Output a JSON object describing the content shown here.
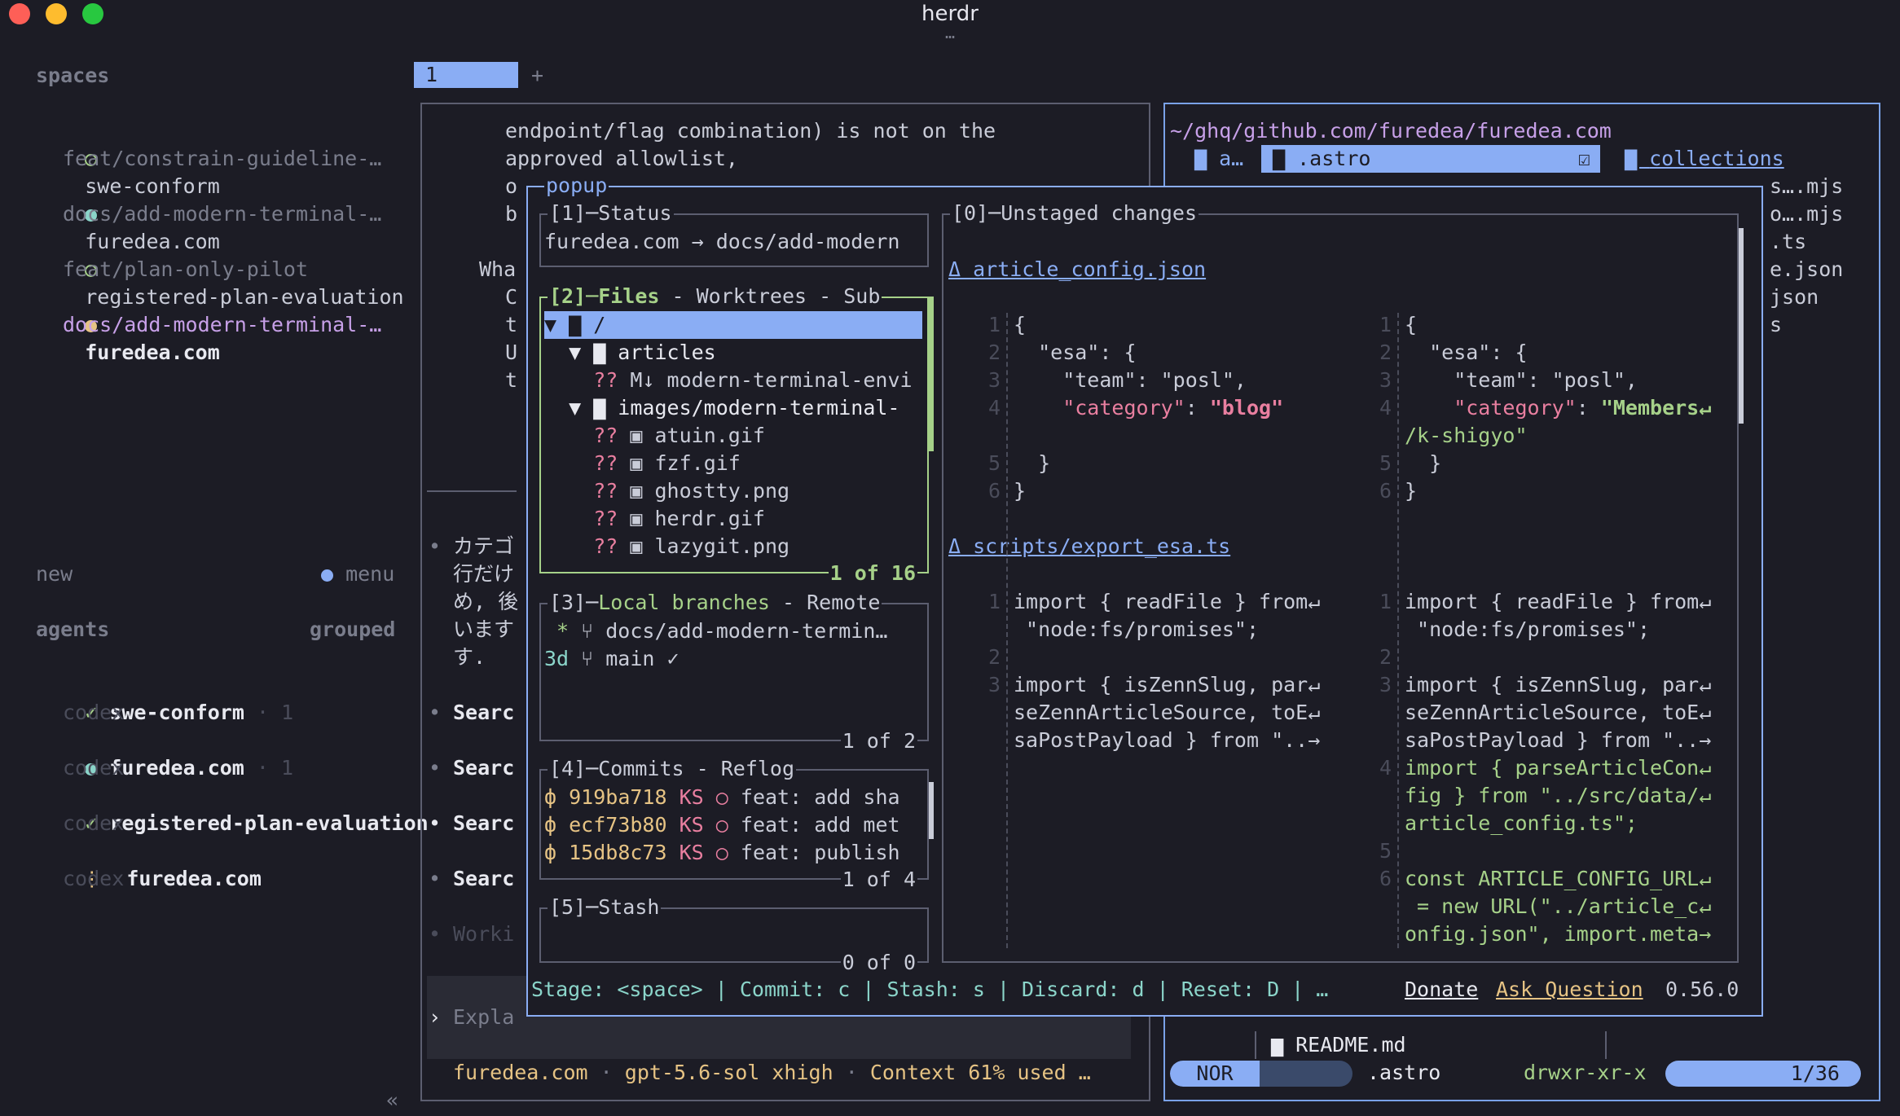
{
  "window": {
    "title": "herdr",
    "handle": "…"
  },
  "sidebar": {
    "spaces_header": "spaces",
    "spaces": [
      {
        "name": "swe-conform",
        "branch": "feat/constrain-guideline-…"
      },
      {
        "name": "furedea.com",
        "branch": "docs/add-modern-terminal-…"
      },
      {
        "name": "registered-plan-evaluation",
        "branch": "feat/plan-only-pilot"
      },
      {
        "name": "furedea.com",
        "branch": "docs/add-modern-terminal-…"
      }
    ],
    "new_label": "new",
    "menu_label": "menu",
    "agents_header": "agents",
    "grouped_label": "grouped",
    "agents": [
      {
        "mark": "✓",
        "name": "swe-conform",
        "count": "· 1",
        "tool": "codex"
      },
      {
        "mark": "",
        "name": "furedea.com",
        "count": "· 1",
        "tool": "codex"
      },
      {
        "mark": "✓",
        "name": "registered-plan-evaluation",
        "count": "",
        "tool": "codex"
      },
      {
        "mark": "⋮",
        "name": "furedea.com",
        "count": "",
        "tool": "codex"
      }
    ],
    "collapse": "«"
  },
  "tabs": {
    "active": "1",
    "add": "+"
  },
  "left_pane": {
    "lines": [
      "endpoint/flag combination) is not on the",
      "approved allowlist,"
    ],
    "frag_o": "o",
    "frag_b": "b",
    "frag_wha": "Wha",
    "frag_col": [
      "C",
      "t",
      "U",
      "t"
    ],
    "bullet_jp": [
      "カテゴ",
      "行だけ",
      "め, 後",
      "います",
      "す."
    ],
    "bullets": [
      "Searc",
      "Searc",
      "Searc",
      "Searc",
      "Worki"
    ],
    "bullet_mark": "•",
    "prompt_mark": "›",
    "prompt": "Expla",
    "status_repo": "furedea.com",
    "status_sep": "·",
    "status_model": "gpt-5.6-sol xhigh",
    "status_context": "Context 61% used …"
  },
  "right_pane": {
    "path": "~/ghq/github.com/furedea/furedea.com",
    "tab_a": "a…",
    "tab_astro": ".astro",
    "tab_collections": "collections",
    "files": [
      "s….mjs",
      "o….mjs",
      ".ts",
      "e.json",
      "json",
      "s"
    ],
    "readme": "README.md",
    "mode": "NOR",
    "mode_name": ".astro",
    "perms": "drwxr-xr-x",
    "position": "1/36"
  },
  "popup": {
    "title": "popup",
    "status": {
      "label": "[1]─Status",
      "text": "furedea.com → docs/add-modern"
    },
    "files": {
      "label_main": "[2]─Files",
      "label_rest": " - Worktrees - Sub",
      "footer": "1 of 16",
      "rows": [
        {
          "status": "",
          "text": "▼ ▇ /"
        },
        {
          "status": "",
          "text": "  ▼ ▇ articles"
        },
        {
          "status": "??",
          "text": "M↓ modern-terminal-envi"
        },
        {
          "status": "",
          "text": "  ▼ ▇ images/modern-terminal-"
        },
        {
          "status": "??",
          "text": "▣ atuin.gif"
        },
        {
          "status": "??",
          "text": "▣ fzf.gif"
        },
        {
          "status": "??",
          "text": "▣ ghostty.png"
        },
        {
          "status": "??",
          "text": "▣ herdr.gif"
        },
        {
          "status": "??",
          "text": "▣ lazygit.png"
        }
      ]
    },
    "branches": {
      "label_main": "[3]─",
      "label_local": "Local branches",
      "label_rest": " - Remote",
      "footer": "1 of 2",
      "rows": [
        {
          "prefix": " *",
          "name": " docs/add-modern-termin…"
        },
        {
          "prefix": "3d",
          "name": " main ✓"
        }
      ]
    },
    "commits": {
      "label_main": "[4]─Commits",
      "label_rest": " - Reflog",
      "footer": "1 of 4",
      "rows": [
        {
          "hash": "919ba718",
          "author": "KS",
          "msg": "feat: add sha"
        },
        {
          "hash": "ecf73b80",
          "author": "KS",
          "msg": "feat: add met"
        },
        {
          "hash": "15db8c73",
          "author": "KS",
          "msg": "feat: publish"
        }
      ]
    },
    "stash": {
      "label": "[5]─Stash",
      "footer": "0 of 0"
    },
    "diff": {
      "label": "[0]─Unstaged changes",
      "file1": "Δ article_config.json",
      "file2": "Δ scripts/export_esa.ts",
      "left1": [
        {
          "n": "1",
          "code": "{"
        },
        {
          "n": "2",
          "code": "  \"esa\": {"
        },
        {
          "n": "3",
          "code": "    \"team\": \"posl\","
        },
        {
          "n": "4",
          "key": "    \"category\"",
          "code": ": ",
          "val": "\"blog\""
        },
        {
          "n": "",
          "code": ""
        },
        {
          "n": "5",
          "code": "  }"
        },
        {
          "n": "6",
          "code": "}"
        }
      ],
      "right1": [
        {
          "n": "1",
          "code": "{"
        },
        {
          "n": "2",
          "code": "  \"esa\": {"
        },
        {
          "n": "3",
          "code": "    \"team\": \"posl\","
        },
        {
          "n": "4",
          "key": "    \"category\"",
          "code": ": ",
          "val": "\"Members↵"
        },
        {
          "n": "",
          "val": "/k-shigyo\""
        },
        {
          "n": "5",
          "code": "  }"
        },
        {
          "n": "6",
          "code": "}"
        }
      ],
      "left2": [
        {
          "n": "1",
          "code": "import { readFile } from↵"
        },
        {
          "n": "",
          "code": " \"node:fs/promises\";"
        },
        {
          "n": "2",
          "code": ""
        },
        {
          "n": "3",
          "code": "import { isZennSlug, par↵"
        },
        {
          "n": "",
          "code": "seZennArticleSource, toE↵"
        },
        {
          "n": "",
          "code": "saPostPayload } from \"..→"
        }
      ],
      "right2": [
        {
          "n": "1",
          "code": "import { readFile } from↵"
        },
        {
          "n": "",
          "code": " \"node:fs/promises\";"
        },
        {
          "n": "2",
          "code": ""
        },
        {
          "n": "3",
          "code": "import { isZennSlug, par↵"
        },
        {
          "n": "",
          "code": "seZennArticleSource, toE↵"
        },
        {
          "n": "",
          "code": "saPostPayload } from \"..→"
        },
        {
          "n": "4",
          "val": "import { parseArticleCon↵"
        },
        {
          "n": "",
          "val": "fig } from \"../src/data/↵"
        },
        {
          "n": "",
          "val": "article_config.ts\";"
        },
        {
          "n": "5",
          "val": ""
        },
        {
          "n": "6",
          "val": "const ARTICLE_CONFIG_URL↵"
        },
        {
          "n": "",
          "val": " = new URL(\"../article_c↵"
        },
        {
          "n": "",
          "val": "onfig.json\", import.meta→"
        }
      ]
    },
    "keybar": "Stage: <space> | Commit: c | Stash: s | Discard: d | Reset: D | …",
    "donate": "Donate",
    "ask": "Ask Question",
    "version": "0.56.0"
  },
  "colors": {
    "background": "#1c1c25",
    "accent_blue": "#8aadf4",
    "accent_green": "#a6d189",
    "accent_pink": "#e97fa0",
    "dot_red": "#fe5f57",
    "dot_yellow": "#febc2e",
    "dot_green": "#28c840"
  }
}
